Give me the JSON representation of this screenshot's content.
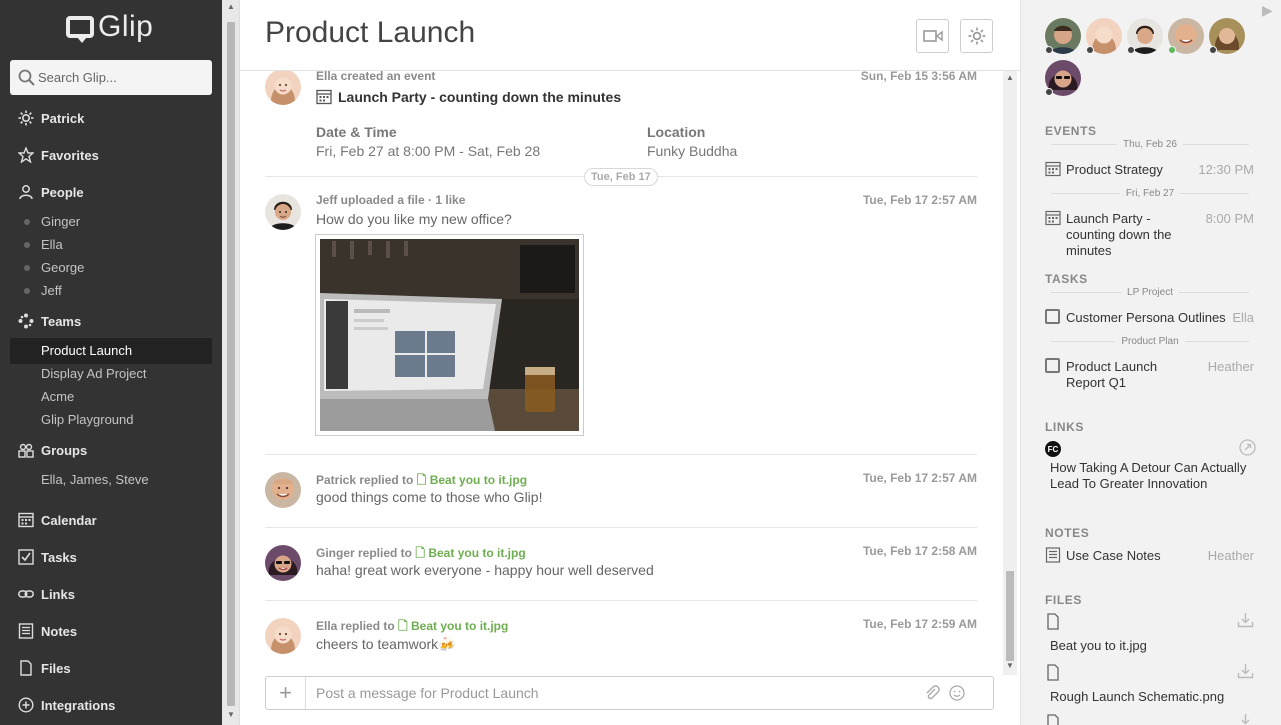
{
  "app": {
    "logo": "Glip"
  },
  "search": {
    "placeholder": "Search Glip..."
  },
  "sidebar": {
    "me": "Patrick",
    "favorites": "Favorites",
    "people": {
      "label": "People",
      "items": [
        "Ginger",
        "Ella",
        "George",
        "Jeff"
      ]
    },
    "teams": {
      "label": "Teams",
      "items": [
        "Product Launch",
        "Display Ad Project",
        "Acme",
        "Glip Playground"
      ]
    },
    "groups": {
      "label": "Groups",
      "items": [
        "Ella, James, Steve"
      ]
    },
    "calendar": "Calendar",
    "tasks": "Tasks",
    "links": "Links",
    "notes": "Notes",
    "files": "Files",
    "integrations": "Integrations"
  },
  "header": {
    "title": "Product Launch"
  },
  "messages": {
    "event": {
      "meta": "Ella created an event",
      "time": "Sun, Feb 15 3:56 AM",
      "title": "Launch Party - counting down the minutes",
      "date_label": "Date & Time",
      "date_value": "Fri, Feb 27 at 8:00 PM - Sat, Feb 28",
      "loc_label": "Location",
      "loc_value": "Funky Buddha"
    },
    "divider": "Tue, Feb 17",
    "upload": {
      "meta": "Jeff uploaded a file · 1 like",
      "time": "Tue, Feb 17 2:57 AM",
      "text": "How do you like my new office?"
    },
    "replies": [
      {
        "author": "Patrick replied to",
        "file": "Beat you to it.jpg",
        "time": "Tue, Feb 17 2:57 AM",
        "text": "good things come to those who Glip!"
      },
      {
        "author": "Ginger replied to",
        "file": "Beat you to it.jpg",
        "time": "Tue, Feb 17 2:58 AM",
        "text": "haha! great work everyone - happy hour well deserved"
      },
      {
        "author": "Ella replied to",
        "file": "Beat you to it.jpg",
        "time": "Tue, Feb 17 2:59 AM",
        "text": "cheers to teamwork🍻"
      }
    ]
  },
  "composer": {
    "placeholder": "Post a message for Product Launch"
  },
  "right": {
    "events": {
      "label": "EVENTS",
      "items": [
        {
          "date": "Thu, Feb 26",
          "title": "Product Strategy",
          "time": "12:30 PM"
        },
        {
          "date": "Fri, Feb 27",
          "title": "Launch Party - counting down the minutes",
          "time": "8:00 PM"
        }
      ]
    },
    "tasks": {
      "label": "TASKS",
      "items": [
        {
          "group": "LP Project",
          "title": "Customer Persona Outlines",
          "assignee": "Ella"
        },
        {
          "group": "Product Plan",
          "title": "Product Launch Report Q1",
          "assignee": "Heather"
        }
      ]
    },
    "links": {
      "label": "LINKS",
      "badge": "FC",
      "title": "How Taking A Detour Can Actually Lead To Greater Innovation"
    },
    "notes": {
      "label": "NOTES",
      "title": "Use Case Notes",
      "author": "Heather"
    },
    "files": {
      "label": "FILES",
      "items": [
        "Beat you to it.jpg",
        "Rough Launch Schematic.png"
      ]
    }
  }
}
